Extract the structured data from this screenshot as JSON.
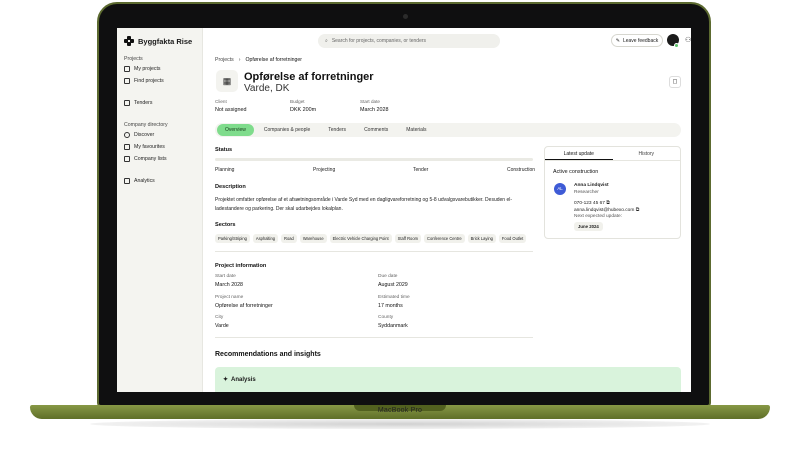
{
  "device": {
    "brand": "MacBook Pro"
  },
  "app": {
    "name": "Byggfakta Rise"
  },
  "sidebar": {
    "sections": [
      {
        "title": "Projects",
        "items": [
          "My projects",
          "Find projects"
        ]
      },
      {
        "title": "",
        "items": [
          "Tenders"
        ]
      },
      {
        "title": "Company directory",
        "items": [
          "Discover",
          "My favourites",
          "Company lists"
        ]
      },
      {
        "title": "",
        "items": [
          "Analytics"
        ]
      }
    ]
  },
  "topbar": {
    "search_placeholder": "Search for projects, companies, or tenders",
    "feedback_label": "Leave feedback"
  },
  "breadcrumb": {
    "root": "Projects",
    "separator": "›",
    "current": "Opførelse af forretninger"
  },
  "project": {
    "title": "Opførelse af forretninger",
    "location": "Varde, DK",
    "meta": [
      {
        "label": "Client",
        "value": "Not assigned"
      },
      {
        "label": "Budget",
        "value": "DKK 200m"
      },
      {
        "label": "Start date",
        "value": "March 2028"
      }
    ]
  },
  "tabs": [
    "Overview",
    "Companies & people",
    "Tenders",
    "Comments",
    "Materials"
  ],
  "active_tab": "Overview",
  "status": {
    "title": "Status",
    "stages": [
      "Planning",
      "Projecting",
      "Tender",
      "Construction"
    ]
  },
  "description": {
    "title": "Description",
    "text": "Projektet omfatter opførelse af et afsætningsområde i Varde Syd med en dagligvareforretning og 5-8 udvalgsvarebutikker. Desuden el-ladestandere og parkering. Der skal udarbejdes lokalplan."
  },
  "sectors": {
    "title": "Sectors",
    "items": [
      "Parking/Striping",
      "Asphalting",
      "Road",
      "Warehouse",
      "Electric Vehicle Charging Point",
      "Staff Room",
      "Conference Centre",
      "Brick Laying",
      "Food Outlet"
    ]
  },
  "project_information": {
    "title": "Project information",
    "fields": [
      {
        "label": "Start date",
        "value": "March 2028"
      },
      {
        "label": "Due date",
        "value": "August 2029"
      },
      {
        "label": "Project name",
        "value": "Opførelse af forretninger"
      },
      {
        "label": "Estimated time",
        "value": "17 months"
      },
      {
        "label": "City",
        "value": "Varde"
      },
      {
        "label": "County",
        "value": "Syddanmark"
      }
    ]
  },
  "recommendations": {
    "title": "Recommendations and insights",
    "analysis_label": "Analysis"
  },
  "update_panel": {
    "tabs": [
      "Latest update",
      "History"
    ],
    "heading": "Active construction",
    "avatar_initials": "AL",
    "name": "Anna Lindqvist",
    "role": "Researcher",
    "phone": "070-123 45 67",
    "email": "anna.lindqvist@hubexo.com",
    "next_label": "Next expected update:",
    "next_date": "June 2024"
  },
  "colors": {
    "accent_green": "#7fdc8c",
    "analysis_bg": "#d9f3dc",
    "avatar_blue": "#3e5bd6",
    "frame_green": "#6f7f32"
  }
}
